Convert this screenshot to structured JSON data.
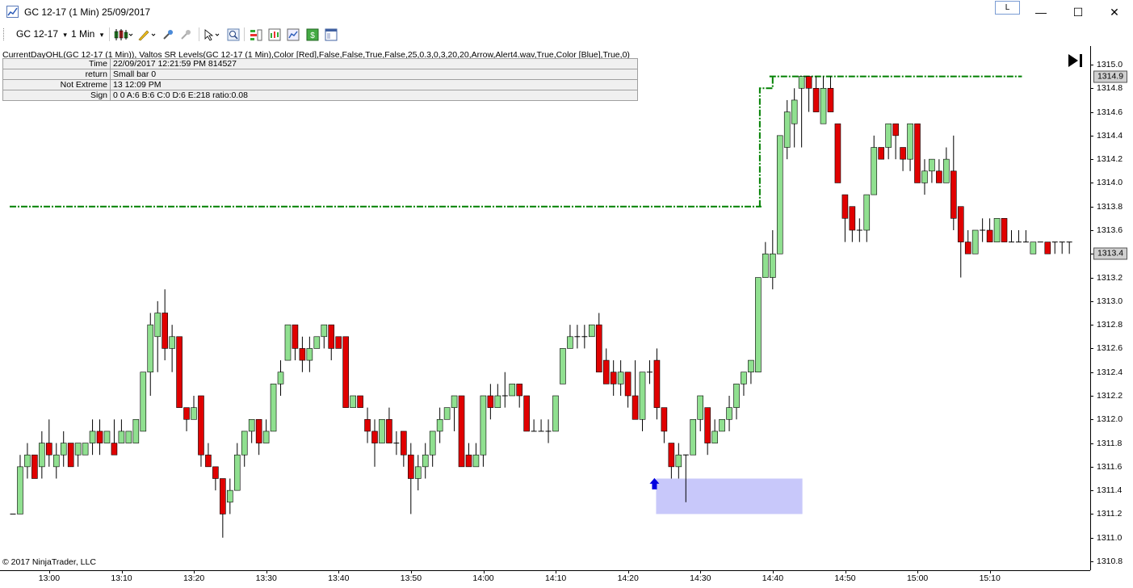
{
  "window": {
    "title": "GC 12-17 (1 Min)  25/09/2017",
    "l_button": "L",
    "minimize": "—",
    "maximize": "☐",
    "close": "✕"
  },
  "toolbar": {
    "instrument": "GC 12-17",
    "interval": "1 Min",
    "dropdown_glyph": "▾"
  },
  "indicator_line": "CurrentDayOHL(GC 12-17 (1 Min)), Valtos SR Levels(GC 12-17 (1 Min),Color [Red],False,False,True,False,25,0.3,0,3,20,20,Arrow,Alert4.wav,True,Color [Blue],True,0)",
  "data_rows": [
    {
      "key": "Time",
      "value": "22/09/2017 12:21:59 PM 814527"
    },
    {
      "key": "return",
      "value": "Small bar 0"
    },
    {
      "key": "Not Extreme",
      "value": "13 12:09 PM"
    },
    {
      "key": "Sign",
      "value": "0 0 A:6 B:6 C:0 D:6 E:218 ratio:0.08"
    }
  ],
  "copyright": "© 2017 NinjaTrader, LLC",
  "colors": {
    "up": "#90e090",
    "down": "#e00000",
    "wick": "#000000",
    "level": "#008000",
    "zone": "#c8c8fa",
    "arrow": "#0000e0",
    "pricebox": "#d0d0d0"
  },
  "chart_data": {
    "type": "candlestick",
    "x_ticks": [
      "13:00",
      "13:10",
      "13:20",
      "13:30",
      "13:40",
      "13:50",
      "14:00",
      "14:10",
      "14:20",
      "14:30",
      "14:40",
      "14:50",
      "15:00",
      "15:10"
    ],
    "y_ticks": [
      "1315.0",
      "1314.8",
      "1314.6",
      "1314.4",
      "1314.2",
      "1314.0",
      "1313.8",
      "1313.6",
      "1313.4",
      "1313.2",
      "1313.0",
      "1312.8",
      "1312.6",
      "1312.4",
      "1312.2",
      "1312.0",
      "1311.8",
      "1311.6",
      "1311.4",
      "1311.2",
      "1311.0",
      "1310.8"
    ],
    "ylim": [
      1310.8,
      1315.0
    ],
    "start_time": "12:58",
    "last_price": "1313.4",
    "high_price": "1314.9",
    "levels": [
      {
        "price": 1313.8,
        "from": "12:58",
        "to": "14:41"
      },
      {
        "price": 1314.9,
        "from": "14:43",
        "to": "15:17"
      }
    ],
    "level_step": {
      "from_price": 1313.8,
      "to_price": 1314.8,
      "at": "14:41"
    },
    "zone": {
      "top": 1311.5,
      "bottom": 1311.2,
      "from": "14:27",
      "to": "14:47"
    },
    "signal_arrow": {
      "time": "14:27",
      "price": 1311.45,
      "direction": "up"
    },
    "candles": [
      [
        1311.2,
        1311.2,
        1311.1,
        1311.1
      ],
      [
        1311.2,
        1311.6,
        1311.7,
        1311.2
      ],
      [
        1311.6,
        1311.7,
        1311.8,
        1311.5
      ],
      [
        1311.7,
        1311.5,
        1311.7,
        1311.5
      ],
      [
        1311.6,
        1311.8,
        1311.9,
        1311.5
      ],
      [
        1311.8,
        1311.7,
        1312.0,
        1311.6
      ],
      [
        1311.6,
        1311.7,
        1311.8,
        1311.5
      ],
      [
        1311.7,
        1311.8,
        1311.9,
        1311.6
      ],
      [
        1311.8,
        1311.6,
        1311.8,
        1311.6
      ],
      [
        1311.7,
        1311.8,
        1311.8,
        1311.6
      ],
      [
        1311.7,
        1311.8,
        1311.8,
        1311.7
      ],
      [
        1311.8,
        1311.9,
        1312.0,
        1311.7
      ],
      [
        1311.9,
        1311.8,
        1312.0,
        1311.7
      ],
      [
        1311.8,
        1311.9,
        1311.9,
        1311.8
      ],
      [
        1311.8,
        1311.7,
        1312.0,
        1311.7
      ],
      [
        1311.8,
        1311.9,
        1312.0,
        1311.8
      ],
      [
        1311.8,
        1311.9,
        1311.9,
        1311.8
      ],
      [
        1311.8,
        1312.0,
        1312.0,
        1311.8
      ],
      [
        1311.9,
        1312.4,
        1312.4,
        1311.9
      ],
      [
        1312.4,
        1312.8,
        1312.9,
        1312.2
      ],
      [
        1312.7,
        1312.9,
        1313.0,
        1312.4
      ],
      [
        1312.9,
        1312.6,
        1313.1,
        1312.5
      ],
      [
        1312.6,
        1312.7,
        1312.8,
        1312.4
      ],
      [
        1312.7,
        1312.1,
        1312.7,
        1312.1
      ],
      [
        1312.1,
        1312.0,
        1312.1,
        1311.9
      ],
      [
        1312.0,
        1312.1,
        1312.2,
        1312.0
      ],
      [
        1312.2,
        1311.7,
        1312.2,
        1311.6
      ],
      [
        1311.7,
        1311.6,
        1311.8,
        1311.6
      ],
      [
        1311.6,
        1311.5,
        1311.6,
        1311.4
      ],
      [
        1311.5,
        1311.2,
        1311.5,
        1311.0
      ],
      [
        1311.3,
        1311.4,
        1311.5,
        1311.2
      ],
      [
        1311.4,
        1311.7,
        1311.8,
        1311.4
      ],
      [
        1311.7,
        1311.9,
        1311.9,
        1311.6
      ],
      [
        1311.9,
        1312.0,
        1312.0,
        1311.8
      ],
      [
        1312.0,
        1311.8,
        1312.0,
        1311.7
      ],
      [
        1311.8,
        1311.9,
        1312.0,
        1311.8
      ],
      [
        1311.9,
        1312.3,
        1312.3,
        1311.9
      ],
      [
        1312.3,
        1312.4,
        1312.5,
        1312.2
      ],
      [
        1312.5,
        1312.8,
        1312.8,
        1312.5
      ],
      [
        1312.8,
        1312.6,
        1312.8,
        1312.5
      ],
      [
        1312.6,
        1312.5,
        1312.7,
        1312.4
      ],
      [
        1312.5,
        1312.6,
        1312.7,
        1312.4
      ],
      [
        1312.6,
        1312.7,
        1312.7,
        1312.6
      ],
      [
        1312.7,
        1312.8,
        1312.8,
        1312.6
      ],
      [
        1312.8,
        1312.6,
        1312.8,
        1312.5
      ],
      [
        1312.7,
        1312.6,
        1312.7,
        1312.6
      ],
      [
        1312.7,
        1312.1,
        1312.7,
        1312.1
      ],
      [
        1312.1,
        1312.2,
        1312.2,
        1312.1
      ],
      [
        1312.2,
        1312.1,
        1312.2,
        1312.1
      ],
      [
        1312.0,
        1311.9,
        1312.1,
        1311.8
      ],
      [
        1311.9,
        1311.8,
        1312.0,
        1311.6
      ],
      [
        1311.8,
        1312.0,
        1312.0,
        1311.8
      ],
      [
        1312.0,
        1311.8,
        1312.1,
        1311.8
      ],
      [
        1311.8,
        1311.8,
        1311.9,
        1311.7
      ],
      [
        1311.9,
        1311.7,
        1311.9,
        1311.6
      ],
      [
        1311.7,
        1311.5,
        1311.8,
        1311.2
      ],
      [
        1311.5,
        1311.6,
        1311.7,
        1311.4
      ],
      [
        1311.6,
        1311.7,
        1311.8,
        1311.5
      ],
      [
        1311.7,
        1311.9,
        1311.9,
        1311.6
      ],
      [
        1311.9,
        1312.0,
        1312.1,
        1311.8
      ],
      [
        1312.0,
        1312.1,
        1312.1,
        1312.0
      ],
      [
        1312.1,
        1312.2,
        1312.2,
        1311.9
      ],
      [
        1312.2,
        1311.6,
        1312.2,
        1311.6
      ],
      [
        1311.7,
        1311.6,
        1311.8,
        1311.6
      ],
      [
        1311.6,
        1311.7,
        1311.8,
        1311.6
      ],
      [
        1311.7,
        1312.2,
        1312.2,
        1311.6
      ],
      [
        1312.2,
        1312.1,
        1312.3,
        1312.0
      ],
      [
        1312.1,
        1312.2,
        1312.3,
        1312.1
      ],
      [
        1312.2,
        1312.2,
        1312.4,
        1312.1
      ],
      [
        1312.2,
        1312.3,
        1312.3,
        1312.2
      ],
      [
        1312.3,
        1312.2,
        1312.3,
        1312.1
      ],
      [
        1312.2,
        1311.9,
        1312.2,
        1311.9
      ],
      [
        1311.9,
        1311.9,
        1312.0,
        1311.9
      ],
      [
        1311.9,
        1311.9,
        1312.0,
        1311.9
      ],
      [
        1311.9,
        1311.9,
        1312.0,
        1311.8
      ],
      [
        1311.9,
        1312.2,
        1312.2,
        1311.9
      ],
      [
        1312.3,
        1312.6,
        1312.6,
        1312.3
      ],
      [
        1312.6,
        1312.7,
        1312.8,
        1312.6
      ],
      [
        1312.7,
        1312.7,
        1312.8,
        1312.6
      ],
      [
        1312.7,
        1312.7,
        1312.8,
        1312.6
      ],
      [
        1312.7,
        1312.8,
        1312.8,
        1312.7
      ],
      [
        1312.8,
        1312.4,
        1312.9,
        1312.4
      ],
      [
        1312.5,
        1312.3,
        1312.6,
        1312.3
      ],
      [
        1312.4,
        1312.3,
        1312.5,
        1312.2
      ],
      [
        1312.3,
        1312.4,
        1312.5,
        1312.2
      ],
      [
        1312.4,
        1312.2,
        1312.4,
        1312.1
      ],
      [
        1312.2,
        1312.0,
        1312.5,
        1312.0
      ],
      [
        1312.0,
        1312.4,
        1312.4,
        1311.9
      ],
      [
        1312.4,
        1312.4,
        1312.5,
        1312.3
      ],
      [
        1312.5,
        1312.1,
        1312.6,
        1312.0
      ],
      [
        1312.1,
        1311.9,
        1312.1,
        1311.8
      ],
      [
        1311.8,
        1311.6,
        1311.8,
        1311.5
      ],
      [
        1311.6,
        1311.7,
        1311.8,
        1311.5
      ],
      [
        1311.7,
        1311.7,
        1311.7,
        1311.3
      ],
      [
        1311.7,
        1312.0,
        1312.0,
        1311.7
      ],
      [
        1312.0,
        1312.2,
        1312.2,
        1311.9
      ],
      [
        1312.1,
        1311.8,
        1312.1,
        1311.7
      ],
      [
        1311.8,
        1311.9,
        1312.0,
        1311.8
      ],
      [
        1311.9,
        1312.0,
        1312.0,
        1311.9
      ],
      [
        1312.0,
        1312.1,
        1312.2,
        1311.9
      ],
      [
        1312.1,
        1312.3,
        1312.3,
        1312.0
      ],
      [
        1312.3,
        1312.4,
        1312.4,
        1312.2
      ],
      [
        1312.4,
        1312.5,
        1312.5,
        1312.3
      ],
      [
        1312.4,
        1313.2,
        1313.2,
        1312.4
      ],
      [
        1313.2,
        1313.4,
        1313.5,
        1313.2
      ],
      [
        1313.2,
        1313.4,
        1313.6,
        1313.1
      ],
      [
        1313.4,
        1314.4,
        1314.4,
        1313.4
      ],
      [
        1314.3,
        1314.6,
        1314.7,
        1314.2
      ],
      [
        1314.5,
        1314.7,
        1314.8,
        1314.3
      ],
      [
        1314.8,
        1314.9,
        1314.9,
        1314.3
      ],
      [
        1314.9,
        1314.8,
        1314.9,
        1314.6
      ],
      [
        1314.8,
        1314.6,
        1314.9,
        1314.6
      ],
      [
        1314.5,
        1314.8,
        1314.9,
        1314.5
      ],
      [
        1314.8,
        1314.6,
        1314.9,
        1314.6
      ],
      [
        1314.5,
        1314.0,
        1314.5,
        1314.0
      ],
      [
        1313.9,
        1313.7,
        1313.9,
        1313.5
      ],
      [
        1313.8,
        1313.6,
        1313.8,
        1313.5
      ],
      [
        1313.6,
        1313.6,
        1313.7,
        1313.5
      ],
      [
        1313.6,
        1313.9,
        1313.9,
        1313.5
      ],
      [
        1313.9,
        1314.3,
        1314.4,
        1313.9
      ],
      [
        1314.3,
        1314.2,
        1314.3,
        1314.2
      ],
      [
        1314.3,
        1314.5,
        1314.5,
        1314.2
      ],
      [
        1314.5,
        1314.4,
        1314.5,
        1314.2
      ],
      [
        1314.3,
        1314.2,
        1314.3,
        1314.1
      ],
      [
        1314.2,
        1314.5,
        1314.5,
        1314.1
      ],
      [
        1314.5,
        1314.0,
        1314.5,
        1314.0
      ],
      [
        1314.0,
        1314.1,
        1314.2,
        1313.9
      ],
      [
        1314.1,
        1314.2,
        1314.2,
        1314.0
      ],
      [
        1314.1,
        1314.0,
        1314.2,
        1314.0
      ],
      [
        1314.0,
        1314.2,
        1314.3,
        1314.0
      ],
      [
        1314.1,
        1313.7,
        1314.4,
        1313.6
      ],
      [
        1313.8,
        1313.5,
        1313.8,
        1313.2
      ],
      [
        1313.5,
        1313.4,
        1313.6,
        1313.4
      ],
      [
        1313.4,
        1313.6,
        1313.6,
        1313.4
      ],
      [
        1313.6,
        1313.6,
        1313.7,
        1313.5
      ],
      [
        1313.6,
        1313.5,
        1313.7,
        1313.5
      ],
      [
        1313.5,
        1313.7,
        1313.7,
        1313.5
      ],
      [
        1313.7,
        1313.5,
        1313.7,
        1313.5
      ],
      [
        1313.5,
        1313.5,
        1313.6,
        1313.5
      ],
      [
        1313.5,
        1313.5,
        1313.6,
        1313.5
      ],
      [
        1313.5,
        1313.5,
        1313.6,
        1313.5
      ],
      [
        1313.4,
        1313.5,
        1313.5,
        1313.4
      ],
      [
        1313.5,
        1313.5,
        1313.5,
        1313.5
      ],
      [
        1313.5,
        1313.4,
        1313.5,
        1313.4
      ],
      [
        1313.5,
        1313.5,
        1313.5,
        1313.4
      ],
      [
        1313.5,
        1313.5,
        1313.5,
        1313.4
      ],
      [
        1313.5,
        1313.5,
        1313.5,
        1313.4
      ]
    ]
  }
}
